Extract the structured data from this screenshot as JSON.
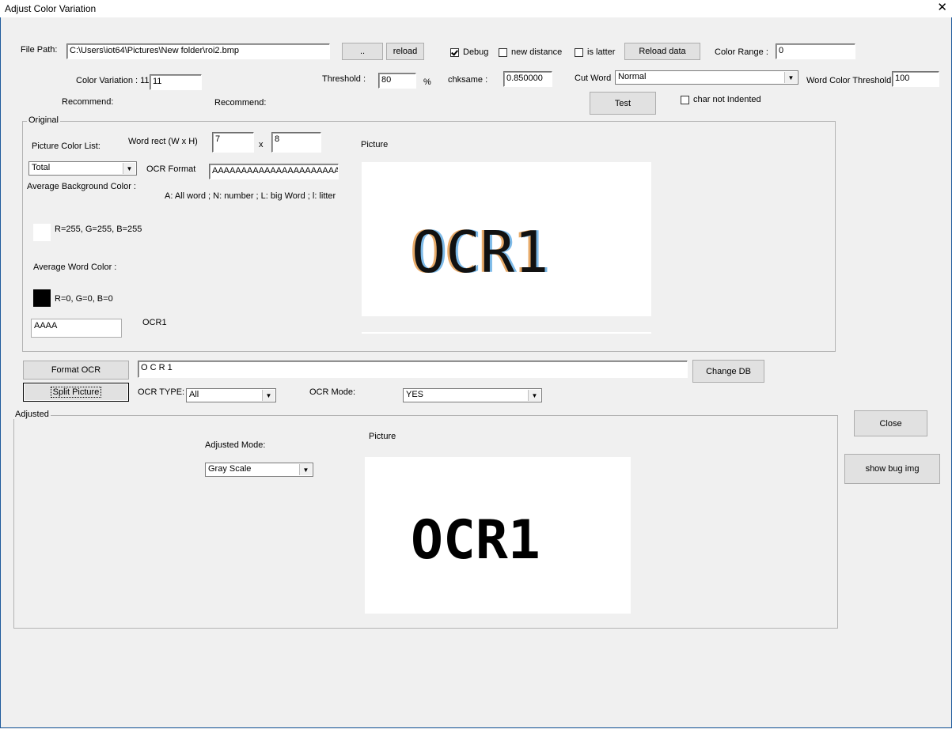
{
  "window": {
    "title": "Adjust Color Variation",
    "close_glyph": "✕"
  },
  "header": {
    "file_path_label": "File Path:",
    "file_path_value": "C:\\Users\\iot64\\Pictures\\New folder\\roi2.bmp",
    "browse_label": "..",
    "reload_label": "reload",
    "debug_label": "Debug",
    "debug_checked": true,
    "new_distance_label": "new distance",
    "new_distance_checked": false,
    "is_latter_label": "is latter",
    "is_latter_checked": false,
    "reload_data_label": "Reload data",
    "color_range_label": "Color Range :",
    "color_range_value": "0",
    "color_variation_label": "Color Variation : 11",
    "color_variation_value": "11",
    "threshold_label": "Threshold :",
    "threshold_value": "80",
    "percent_label": "%",
    "chksame_label": "chksame :",
    "chksame_value": "0.850000",
    "cut_word_label": "Cut Word",
    "cut_word_value": "Normal",
    "word_color_threshold_label": "Word Color Threshold :",
    "word_color_threshold_value": "100",
    "recommend_label_1": "Recommend:",
    "recommend_label_2": "Recommend:",
    "test_label": "Test",
    "char_not_indented_label": "char not Indented",
    "char_not_indented_checked": false
  },
  "original": {
    "group_title": "Original",
    "picture_color_list_label": "Picture Color List:",
    "word_rect_label": "Word  rect (W x H)",
    "word_w": "7",
    "x_label": "x",
    "word_h": "8",
    "picture_label": "Picture",
    "color_list_value": "Total",
    "ocr_format_label": "OCR Format",
    "ocr_format_value": "AAAAAAAAAAAAAAAAAAAAAAAAAA",
    "avg_bg_label": "Average Background Color :",
    "legend_text": "A: All word ; N: number ; L: big Word ; l: litter",
    "bg_rgb": "R=255, G=255, B=255",
    "bg_color": "#ffffff",
    "avg_word_label": "Average Word Color :",
    "word_rgb": "R=0, G=0, B=0",
    "word_color": "#000000",
    "ocr_input_value": "AAAA",
    "ocr_result": "OCR1",
    "picture_text": "OCR1"
  },
  "ocr_bar": {
    "format_ocr_label": "Format OCR",
    "format_ocr_value": "O C R 1",
    "change_db_label": "Change DB",
    "split_picture_label": "Split Picture",
    "ocr_type_label": "OCR TYPE:",
    "ocr_type_value": "All",
    "ocr_mode_label": "OCR Mode:",
    "ocr_mode_value": "YES"
  },
  "adjusted": {
    "group_title": "Adjusted",
    "adjusted_mode_label": "Adjusted Mode:",
    "picture_label": "Picture",
    "adjusted_mode_value": "Gray Scale",
    "picture_text": "OCR1"
  },
  "side": {
    "close_label": "Close",
    "show_bug_label": "show bug img"
  }
}
